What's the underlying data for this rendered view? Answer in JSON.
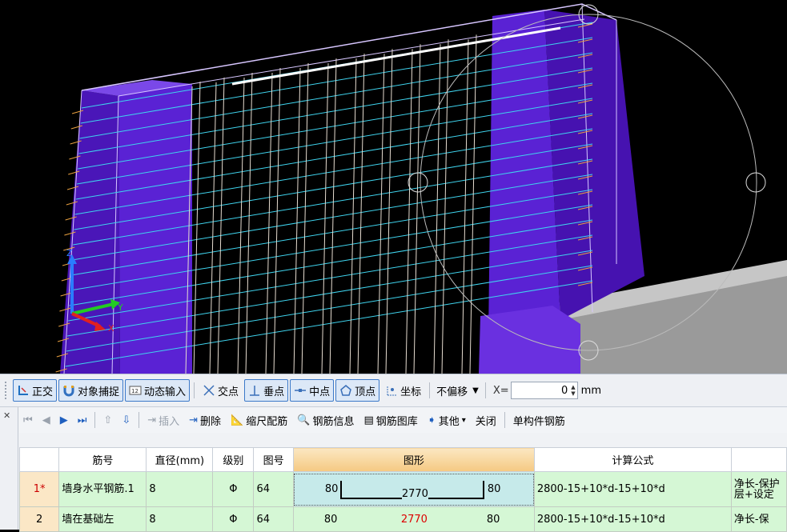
{
  "toolbar": {
    "ortho": "正交",
    "snap": "对象捕捉",
    "dynamic_input": "动态输入",
    "intersection": "交点",
    "perpendicular": "垂点",
    "midpoint": "中点",
    "vertex": "顶点",
    "coordinate": "坐标",
    "offset_mode": "不偏移",
    "x_label": "X=",
    "x_value": "0",
    "unit": "mm"
  },
  "rebar_toolbar": {
    "insert": "插入",
    "delete": "删除",
    "scale_rebar": "缩尺配筋",
    "rebar_info": "钢筋信息",
    "rebar_library": "钢筋图库",
    "other": "其他",
    "close": "关闭",
    "single_member": "单构件钢筋"
  },
  "table": {
    "headers": [
      "筋号",
      "直径(mm)",
      "级别",
      "图号",
      "图形",
      "计算公式",
      ""
    ],
    "rows": [
      {
        "index": "1*",
        "name": "墙身水平钢筋.1",
        "diameter": "8",
        "grade": "Φ",
        "shape_no": "64",
        "shape_left": "80",
        "shape_mid": "2770",
        "shape_right": "80",
        "formula": "2800-15+10*d-15+10*d",
        "note": "净长-保护层+设定"
      },
      {
        "index": "2",
        "name": "墙在基础左",
        "diameter": "8",
        "grade": "Φ",
        "shape_no": "64",
        "shape_left": "80",
        "shape_mid": "2770",
        "shape_right": "80",
        "formula": "2800-15+10*d-15+10*d",
        "note": "净长-保"
      }
    ]
  },
  "colors": {
    "wall_purple": "#5a1fd0",
    "rebar_cyan": "#3fd4ee",
    "selection_blue": "#3b79c9",
    "row_green": "#d5f7d5"
  }
}
